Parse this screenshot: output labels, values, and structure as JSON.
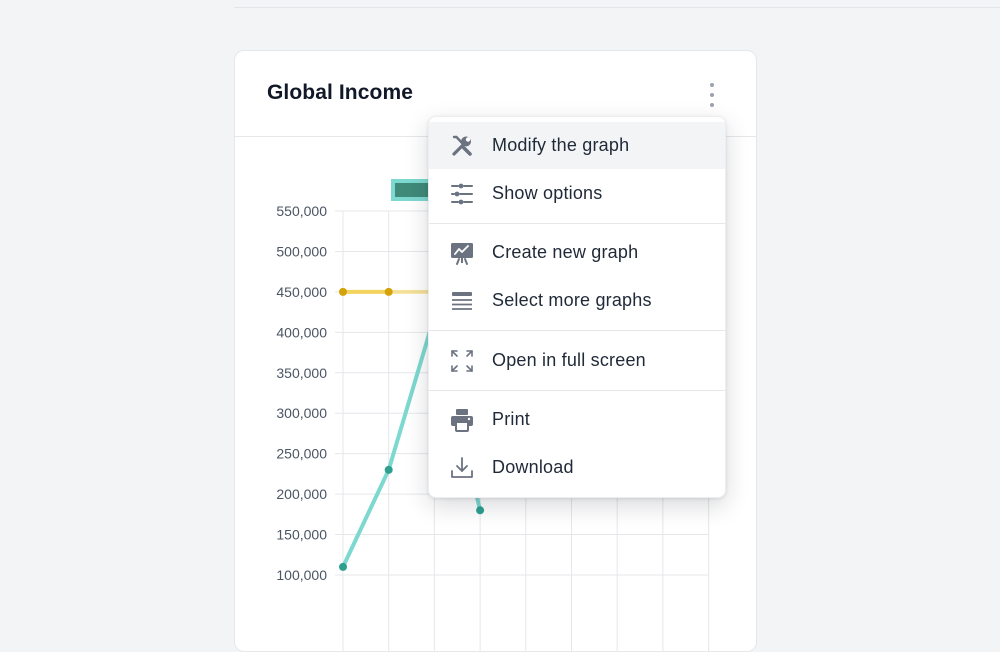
{
  "card": {
    "title": "Global Income"
  },
  "menu": {
    "items": [
      {
        "label": "Modify the graph",
        "icon": "wrench-screwdriver-icon",
        "active": true
      },
      {
        "label": "Show options",
        "icon": "sliders-icon"
      },
      {
        "label": "Create new graph",
        "icon": "presentation-chart-icon"
      },
      {
        "label": "Select more graphs",
        "icon": "list-lines-icon"
      },
      {
        "label": "Open in full screen",
        "icon": "expand-icon"
      },
      {
        "label": "Print",
        "icon": "printer-icon"
      },
      {
        "label": "Download",
        "icon": "download-icon"
      }
    ]
  },
  "chart_data": {
    "type": "line",
    "title": "",
    "xlabel": "",
    "ylabel": "",
    "y_ticks": [
      "550,000",
      "500,000",
      "450,000",
      "400,000",
      "350,000",
      "300,000",
      "250,000",
      "200,000",
      "150,000",
      "100,000"
    ],
    "ylim": [
      100000,
      550000
    ],
    "grid": true,
    "series": [
      {
        "color": "#7dd8d0",
        "point_color": "#2e9e8f",
        "values": [
          110000,
          230000,
          420000,
          180000
        ]
      },
      {
        "color": "#f4d35e",
        "point_color": "#d4a20a",
        "values": [
          450000,
          450000
        ]
      }
    ],
    "legend": [
      {
        "color": "#3f8a79"
      },
      {
        "color": "#fde9a6"
      }
    ]
  },
  "colors": {
    "accent": "#7dd8d0",
    "secondary": "#f4d35e",
    "text": "#1f2937",
    "muted": "#9ca3af"
  }
}
